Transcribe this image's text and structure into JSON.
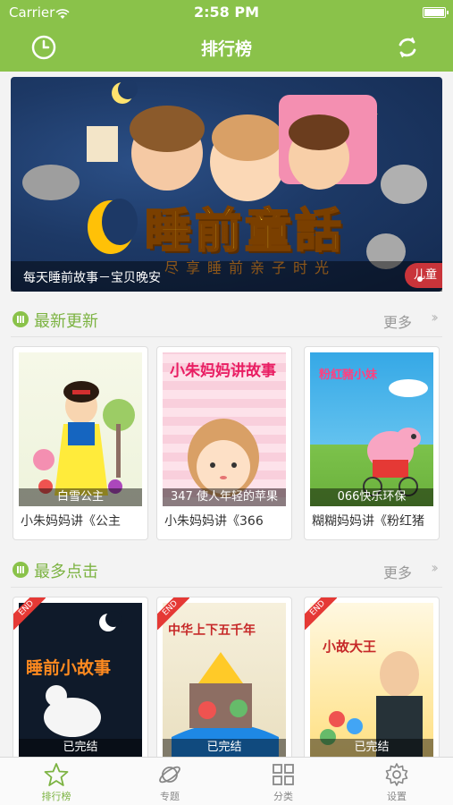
{
  "status_bar": {
    "carrier": "Carrier",
    "time": "2:58 PM"
  },
  "nav": {
    "title": "排行榜",
    "left_icon": "clock-icon",
    "right_icon": "refresh-icon"
  },
  "banner": {
    "title": "睡前童話",
    "subtitle": "尽享睡前亲子时光",
    "caption": "每天睡前故事－宝贝晚安",
    "tag": "儿童",
    "page_indicator": {
      "current": 1
    }
  },
  "sections": [
    {
      "title": "最新更新",
      "more": "更多",
      "items": [
        {
          "cover_caption": "白雪公主",
          "title": "小朱妈妈讲《公主",
          "cover_text": ""
        },
        {
          "cover_caption": "347 使人年轻的苹果",
          "title": "小朱妈妈讲《366",
          "cover_text": "小朱妈妈讲故事"
        },
        {
          "cover_caption": "066快乐环保",
          "title": "糊糊妈妈讲《粉红猪",
          "cover_text": "粉紅豬小妹"
        }
      ]
    },
    {
      "title": "最多点击",
      "more": "更多",
      "items": [
        {
          "badge": "END",
          "cover_caption": "已完结",
          "cover_text": "睡前小故事"
        },
        {
          "badge": "END",
          "cover_caption": "已完结",
          "cover_text": "中华上下五千年"
        },
        {
          "badge": "END",
          "cover_caption": "已完结",
          "cover_text": "小故大王"
        }
      ]
    }
  ],
  "tabs": [
    {
      "label": "排行榜",
      "icon": "star-icon",
      "active": true
    },
    {
      "label": "专题",
      "icon": "planet-icon",
      "active": false
    },
    {
      "label": "分类",
      "icon": "grid-icon",
      "active": false
    },
    {
      "label": "设置",
      "icon": "gear-icon",
      "active": false
    }
  ],
  "colors": {
    "brand": "#8ac24a",
    "accent_text": "#7cb342",
    "badge": "#e53935"
  }
}
